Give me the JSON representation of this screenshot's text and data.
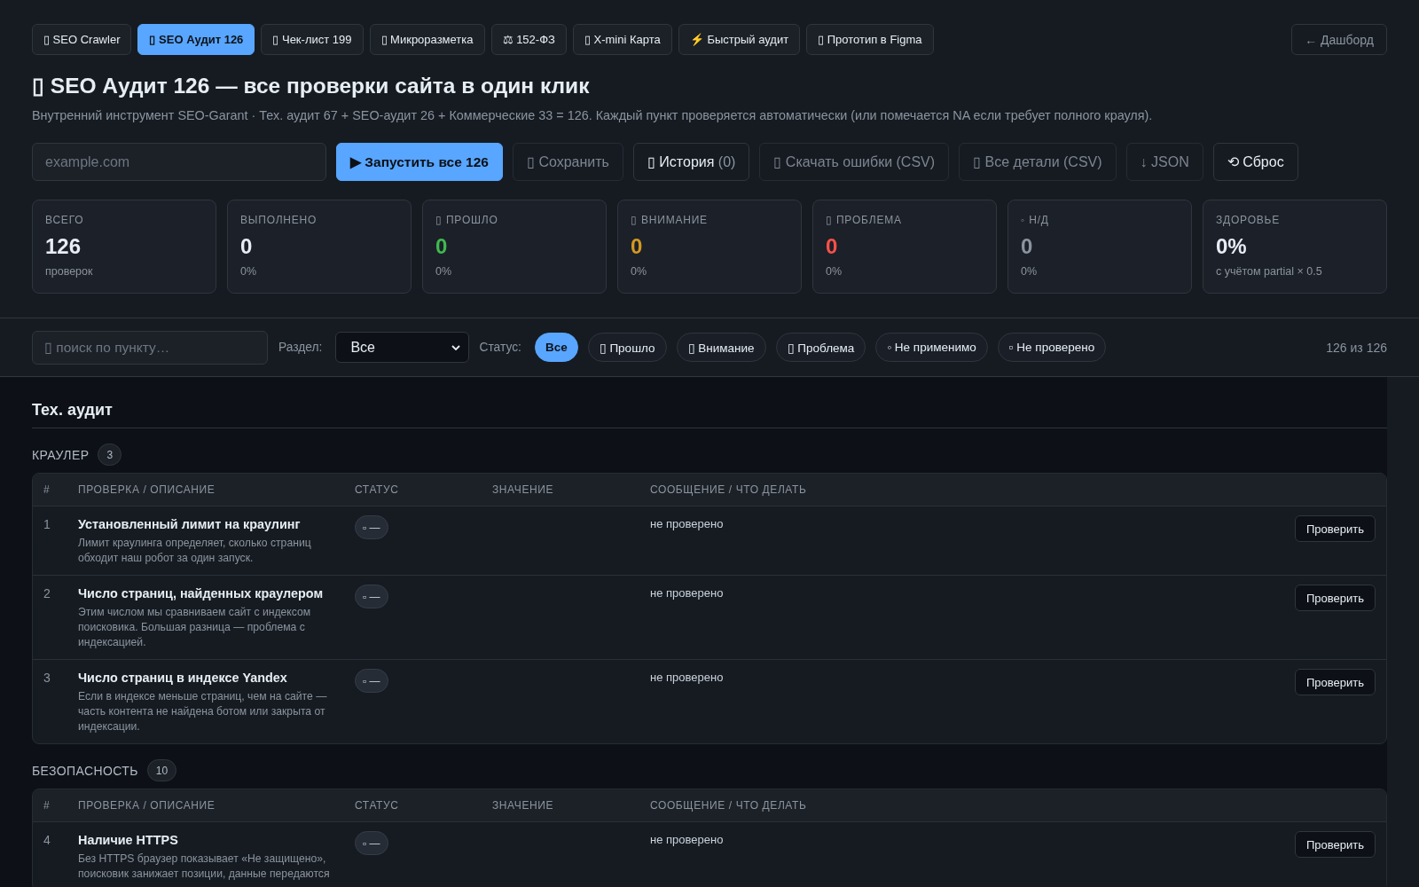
{
  "nav_tabs": [
    {
      "label": "▯ SEO Crawler",
      "selected": false
    },
    {
      "label": "▯ SEO Аудит 126",
      "selected": true
    },
    {
      "label": "▯ Чек-лист 199",
      "selected": false
    },
    {
      "label": "▯ Микроразметка",
      "selected": false
    },
    {
      "label": "⚖ 152-ФЗ",
      "selected": false
    },
    {
      "label": "▯ X-mini Карта",
      "selected": false
    },
    {
      "label": "⚡ Быстрый аудит",
      "selected": false
    },
    {
      "label": "▯ Прототип в Figma",
      "selected": false
    }
  ],
  "dashboard_link": "← Дашборд",
  "title": "▯ SEO Аудит 126 — все проверки сайта в один клик",
  "subtitle": "Внутренний инструмент SEO-Garant · Тех. аудит 67 + SEO-аудит 26 + Коммерческие 33 = 126. Каждый пункт проверяется автоматически (или помечается NA если требует полного крауля).",
  "url_field": {
    "placeholder": "example.com"
  },
  "actions": [
    {
      "label": "▶ Запустить все 126",
      "kind": "primary",
      "disabled": false
    },
    {
      "label": "▯ Сохранить",
      "kind": "default",
      "disabled": true
    },
    {
      "label": "▯ История",
      "count": "(0)",
      "kind": "default",
      "disabled": false
    },
    {
      "label": "▯ Скачать ошибки (CSV)",
      "kind": "default",
      "disabled": true
    },
    {
      "label": "▯ Все детали (CSV)",
      "kind": "default",
      "disabled": true
    },
    {
      "label": "↓ JSON",
      "kind": "default",
      "disabled": true
    },
    {
      "label": "⟲ Сброс",
      "kind": "default",
      "disabled": false
    }
  ],
  "stats": [
    {
      "label": "ВСЕГО",
      "value": "126",
      "note": "проверок",
      "color": "#e6edf3"
    },
    {
      "label": "ВЫПОЛНЕНО",
      "value": "0",
      "note": "0%",
      "color": "#e6edf3"
    },
    {
      "label": "▯ ПРОШЛО",
      "value": "0",
      "note": "0%",
      "color": "#3fb950"
    },
    {
      "label": "▯ ВНИМАНИЕ",
      "value": "0",
      "note": "0%",
      "color": "#d29922"
    },
    {
      "label": "▯ ПРОБЛЕМА",
      "value": "0",
      "note": "0%",
      "color": "#f85149"
    },
    {
      "label": "◦ Н/Д",
      "value": "0",
      "note": "0%",
      "color": "#8b949e"
    },
    {
      "label": "ЗДОРОВЬЕ",
      "value": "0%",
      "note": "с учётом partial × 0.5",
      "color": "#e6edf3"
    }
  ],
  "filters": {
    "search": {
      "placeholder": "▯ поиск по пункту…"
    },
    "section_label": "Раздел:",
    "section_value": "Все",
    "status_label": "Статус:",
    "status_chips": [
      {
        "label": "Все",
        "selected": true
      },
      {
        "label": "▯ Прошло",
        "selected": false
      },
      {
        "label": "▯ Внимание",
        "selected": false
      },
      {
        "label": "▯ Проблема",
        "selected": false
      },
      {
        "label": "◦ Не применимо",
        "selected": false
      },
      {
        "label": "▫ Не проверено",
        "selected": false
      }
    ],
    "count": "126 из 126"
  },
  "sections": [
    {
      "title": "Тех. аудит",
      "groups": [
        {
          "name": "КРАУЛЕР",
          "count": "3",
          "columns": [
            "#",
            "ПРОВЕРКА / ОПИСАНИЕ",
            "СТАТУС",
            "ЗНАЧЕНИЕ",
            "СООБЩЕНИЕ / ЧТО ДЕЛАТЬ"
          ],
          "rows": [
            {
              "number": "1",
              "title": "Установленный лимит на краулинг",
              "description": "Лимит краулинга определяет, сколько страниц обходит наш робот за один запуск.",
              "status": "▫ —",
              "message": "не проверено",
              "action": "Проверить"
            },
            {
              "number": "2",
              "title": "Число страниц, найденных краулером",
              "description": "Этим числом мы сравниваем сайт с индексом поисковика. Большая разница — проблема с индексацией.",
              "status": "▫ —",
              "message": "не проверено",
              "action": "Проверить"
            },
            {
              "number": "3",
              "title": "Число страниц в индексе Yandex",
              "description": "Если в индексе меньше страниц, чем на сайте — часть контента не найдена ботом или закрыта от индексации.",
              "status": "▫ —",
              "message": "не проверено",
              "action": "Проверить"
            }
          ]
        },
        {
          "name": "БЕЗОПАСНОСТЬ",
          "count": "10",
          "columns": [
            "#",
            "ПРОВЕРКА / ОПИСАНИЕ",
            "СТАТУС",
            "ЗНАЧЕНИЕ",
            "СООБЩЕНИЕ / ЧТО ДЕЛАТЬ"
          ],
          "rows": [
            {
              "number": "4",
              "title": "Наличие HTTPS",
              "description": "Без HTTPS браузер показывает «Не защищено», поисковик занижает позиции, данные передаются",
              "status": "▫ —",
              "message": "не проверено",
              "action": "Проверить"
            }
          ]
        }
      ]
    }
  ]
}
